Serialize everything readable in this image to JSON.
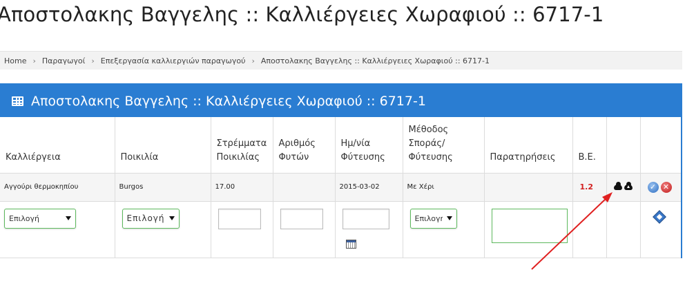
{
  "page_title": "Αποστολακης Βαγγελης :: Καλλιέργειες Χωραφιού :: 6717-1",
  "breadcrumb": [
    "Home",
    "Παραγωγοί",
    "Επεξεργασία καλλιεργιών παραγωγού",
    "Αποστολακης Βαγγελης :: Καλλιέργειες Χωραφιού :: 6717-1"
  ],
  "panel": {
    "title": "Αποστολακης Βαγγελης :: Καλλιέργειες Χωραφιού :: 6717-1",
    "icon": "table-icon"
  },
  "columns": {
    "crop": "Καλλιέργεια",
    "variety": "Ποικιλία",
    "stremmata_1": "Στρέμματα",
    "stremmata_2": "Ποικιλίας",
    "plants_1": "Αριθμός",
    "plants_2": "Φυτών",
    "date_1": "Ημ/νία",
    "date_2": "Φύτευσης",
    "method_1": "Μέθοδος",
    "method_2": "Σποράς/",
    "method_3": "Φύτευσης",
    "notes": "Παρατηρήσεις",
    "be": "Β.Ε."
  },
  "row": {
    "crop": "Αγγούρι θερμοκηπίου",
    "variety": "Burgos",
    "stremmata": "17.00",
    "plants": "",
    "date": "2015-03-02",
    "method": "Με Χέρι",
    "notes": "",
    "be": "1.2"
  },
  "edit_row": {
    "crop_select": "Επιλογή",
    "variety_select": "Επιλογή",
    "method_select": "Επιλογή"
  },
  "colors": {
    "accent": "#2a7dd2",
    "be_value": "#d21e1e",
    "annotation_arrow": "#e02020"
  }
}
